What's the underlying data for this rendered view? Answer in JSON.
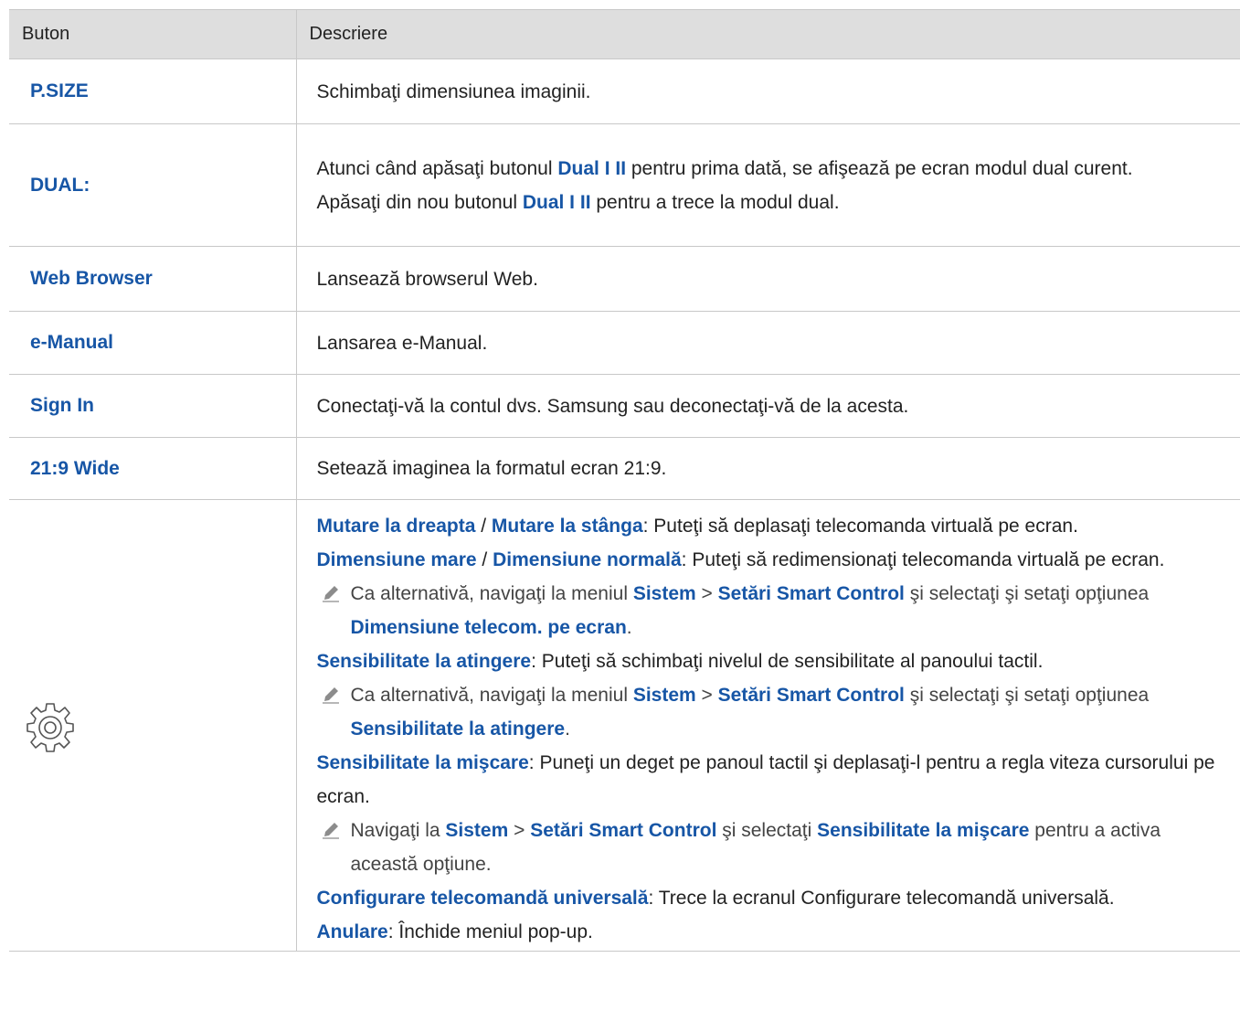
{
  "header": {
    "col1": "Buton",
    "col2": "Descriere"
  },
  "rows": [
    {
      "button": "P.SIZE",
      "desc": "Schimbaţi dimensiunea imaginii."
    },
    {
      "button": "DUAL:",
      "d1": "Atunci când apăsaţi butonul ",
      "d1b": "Dual I II",
      "d1c": " pentru prima dată, se afişează pe ecran modul dual curent.",
      "d2": "Apăsaţi din nou butonul ",
      "d2b": "Dual I II",
      "d2c": " pentru a trece la modul dual."
    },
    {
      "button": "Web Browser",
      "desc": "Lansează browserul Web."
    },
    {
      "button": "e-Manual",
      "desc": "Lansarea e-Manual."
    },
    {
      "button": "Sign In",
      "desc": "Conectaţi-vă la contul dvs. Samsung sau deconectaţi-vă de la acesta."
    },
    {
      "button": "21:9 Wide",
      "desc": "Setează imaginea la formatul ecran 21:9."
    }
  ],
  "settings": {
    "icon": "gear-icon",
    "move_right": "Mutare la dreapta",
    "slash1": " / ",
    "move_left": "Mutare la stânga",
    "move_desc": ": Puteţi să deplasaţi telecomanda virtuală pe ecran.",
    "size_large": "Dimensiune mare",
    "slash2": " / ",
    "size_normal": "Dimensiune normală",
    "size_desc": ": Puteţi să redimensionaţi telecomanda virtuală pe ecran.",
    "note1_a": "Ca alternativă, navigaţi la meniul ",
    "note1_sistem": "Sistem",
    "note1_gt": " > ",
    "note1_setari": "Setări Smart Control",
    "note1_b": " şi selectaţi şi setaţi opţiunea ",
    "note1_opt": "Dimensiune telecom. pe ecran",
    "note1_end": ".",
    "touch": "Sensibilitate la atingere",
    "touch_desc": ": Puteţi să schimbaţi nivelul de sensibilitate al panoului tactil.",
    "note2_a": "Ca alternativă, navigaţi la meniul ",
    "note2_sistem": "Sistem",
    "note2_gt": " > ",
    "note2_setari": "Setări Smart Control",
    "note2_b": " şi selectaţi şi setaţi opţiunea ",
    "note2_opt": "Sensibilitate la atingere",
    "note2_end": ".",
    "motion": "Sensibilitate la mişcare",
    "motion_desc": ": Puneţi un deget pe panoul tactil şi deplasaţi-l pentru a regla viteza cursorului pe ecran.",
    "note3_a": "Navigaţi la ",
    "note3_sistem": "Sistem",
    "note3_gt": " > ",
    "note3_setari": "Setări Smart Control",
    "note3_b": " şi selectaţi ",
    "note3_opt": "Sensibilitate la mişcare",
    "note3_end": " pentru a activa această opţiune.",
    "universal": "Configurare telecomandă universală",
    "universal_desc": ": Trece la ecranul Configurare telecomandă universală.",
    "cancel": "Anulare",
    "cancel_desc": ": Închide meniul pop-up."
  },
  "colors": {
    "accent": "#1756a6",
    "header_bg": "#dedede",
    "border": "#c8c8c8"
  }
}
